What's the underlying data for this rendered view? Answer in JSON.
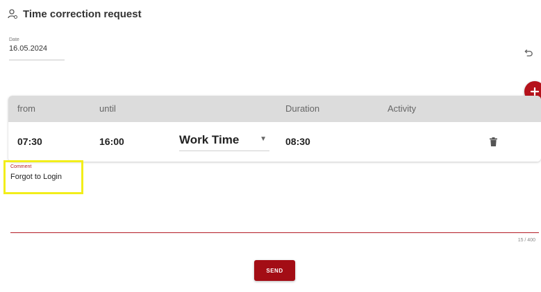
{
  "header": {
    "title": "Time correction request",
    "icon": "person-clock-icon"
  },
  "date": {
    "label": "Date",
    "value": "16.05.2024"
  },
  "actions": {
    "undo_icon": "undo-icon",
    "add_icon": "plus-icon"
  },
  "table": {
    "columns": [
      "from",
      "until",
      "Duration",
      "Activity"
    ],
    "rows": [
      {
        "from": "07:30",
        "until": "16:00",
        "type": "Work Time",
        "duration": "08:30",
        "activity": ""
      }
    ],
    "delete_icon": "trash-icon"
  },
  "comment": {
    "label": "Comment",
    "value": "Forgot to Login",
    "counter": "15 / 400"
  },
  "send": {
    "label": "SEND"
  },
  "colors": {
    "accent": "#a30d15",
    "fab": "#b5121b",
    "highlight": "#f2ee1a",
    "header_bg": "#dcdcdc"
  }
}
